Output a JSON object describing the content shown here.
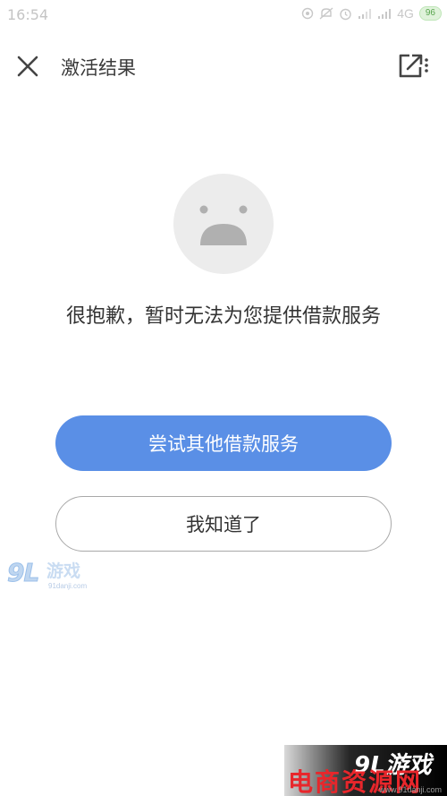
{
  "status_bar": {
    "time": "16:54",
    "network": "4G",
    "battery": "96"
  },
  "header": {
    "title": "激活结果",
    "close_icon": "close-icon",
    "share_icon": "open-external-icon"
  },
  "main": {
    "illustration": "sad-face-icon",
    "message": "很抱歉，暂时无法为您提供借款服务",
    "primary_button": "尝试其他借款服务",
    "secondary_button": "我知道了"
  },
  "watermarks": {
    "small_logo": "9L",
    "small_text": "游戏",
    "small_url": "91danji.com",
    "big_logo": "9L游戏",
    "big_text": "电商资源网",
    "big_url": "www.91danji.com"
  },
  "colors": {
    "primary": "#5a8fe6",
    "face": "#ececec",
    "face_feature": "#b0b0b0"
  }
}
